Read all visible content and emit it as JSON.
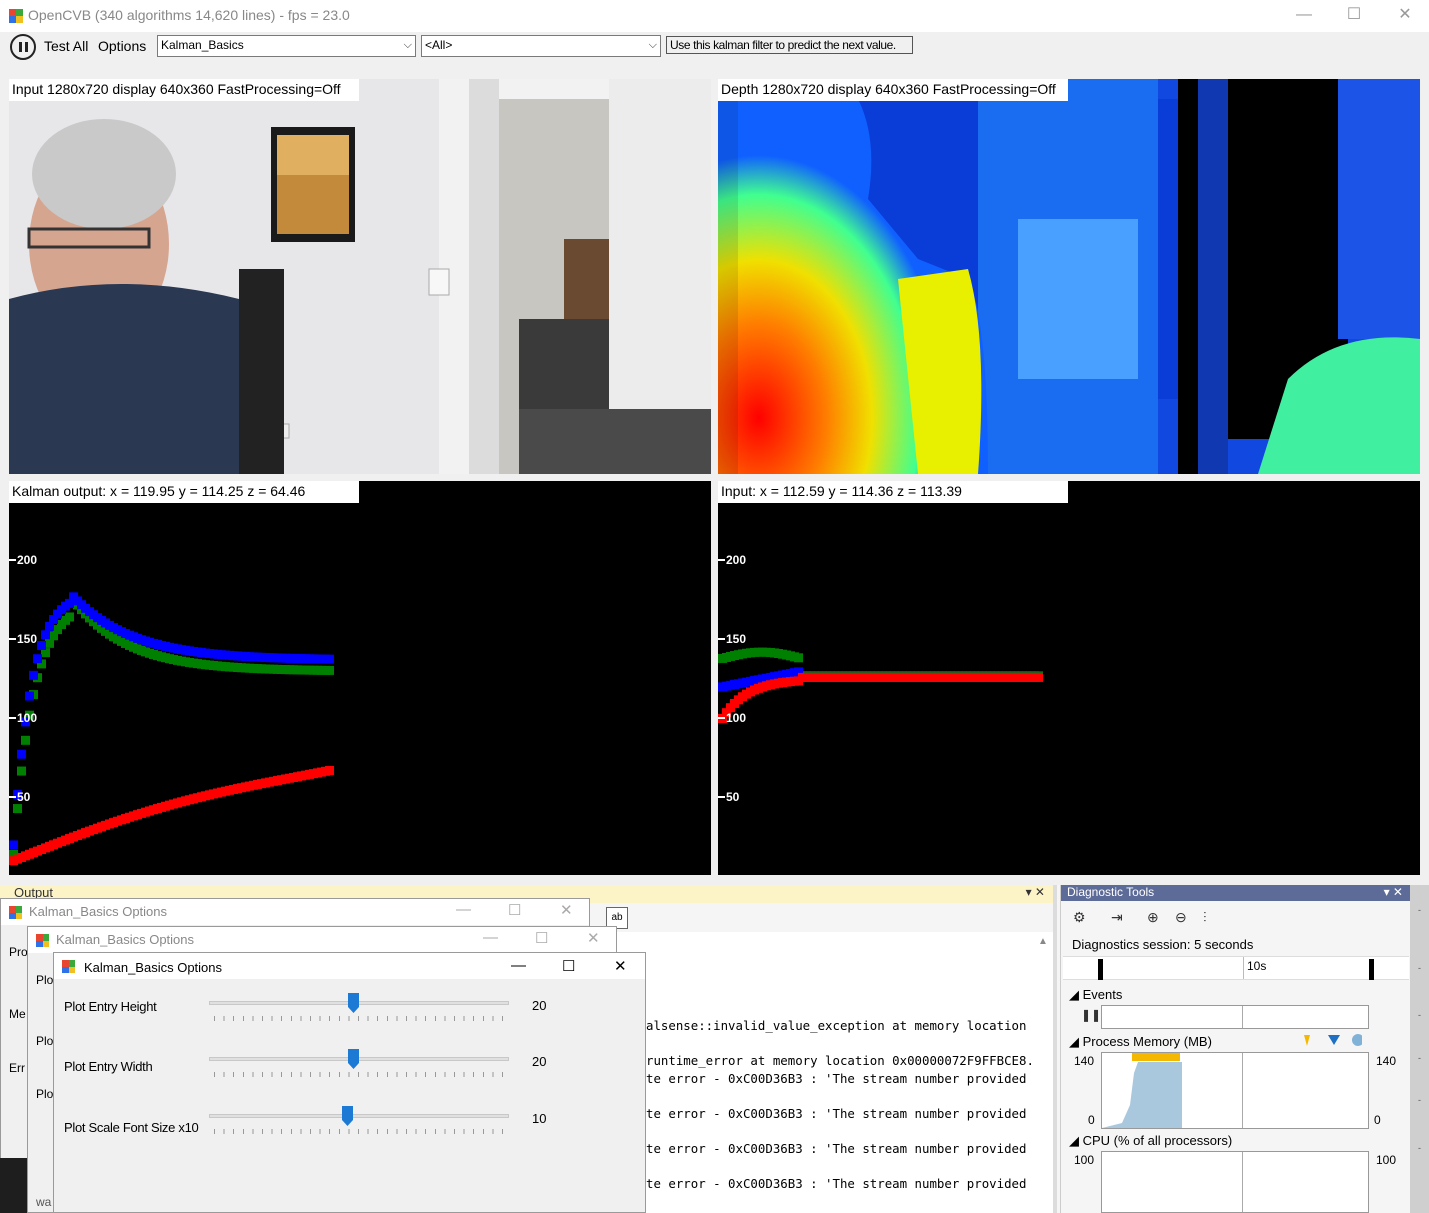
{
  "window": {
    "title": "OpenCVB (340 algorithms 14,620 lines) - fps = 23.0",
    "minimize": "—",
    "maximize": "☐",
    "close": "✕"
  },
  "toolbar": {
    "test_all": "Test All",
    "options": "Options",
    "algorithm": "Kalman_Basics",
    "group": "<All>",
    "description": "Use this kalman filter to predict the next value."
  },
  "panels": {
    "input_label": "Input 1280x720 display 640x360 FastProcessing=Off",
    "depth_label": "Depth 1280x720 display 640x360 FastProcessing=Off",
    "kalman_label": "Kalman output: x = 119.95 y = 114.25 z = 64.46",
    "raw_label": "Input: x = 112.59 y = 114.36 z = 113.39"
  },
  "plot_axis": {
    "ticks": [
      "200",
      "150",
      "100",
      "50"
    ],
    "colors": {
      "x": "#0000ff",
      "y": "#008000",
      "z": "#ff0000"
    }
  },
  "output": {
    "title": "Output",
    "controls": "▾ ✕",
    "lines": [
      "alsense::invalid_value_exception at memory location",
      "runtime_error at memory location 0x00000072F9FFBCE8.",
      "te error - 0xC00D36B3 : 'The stream number provided",
      "te error - 0xC00D36B3 : 'The stream number provided",
      "te error - 0xC00D36B3 : 'The stream number provided",
      "te error - 0xC00D36B3 : 'The stream number provided"
    ]
  },
  "options_dialogs": {
    "title": "Kalman_Basics Options",
    "back_labels_1": [
      "Pro",
      "Me",
      "Err"
    ],
    "back_labels_2": [
      "Plot",
      "Plot",
      "Plot"
    ],
    "bottom_text": "wa",
    "sliders": [
      {
        "label": "Plot Entry Height",
        "value": "20",
        "fraction": 0.48
      },
      {
        "label": "Plot Entry Width",
        "value": "20",
        "fraction": 0.48
      },
      {
        "label": "Plot Scale Font Size x10",
        "value": "10",
        "fraction": 0.46
      }
    ]
  },
  "diagnostics": {
    "title": "Diagnostic Tools",
    "controls": "▾ ✕",
    "session": "Diagnostics session: 5 seconds",
    "timeline_label": "10s",
    "events_label": "Events",
    "memory_label": "Process Memory (MB)",
    "memory_max": "140",
    "memory_min": "0",
    "cpu_label": "CPU (% of all processors)",
    "cpu_max": "100",
    "legend_colors": {
      "gc": "#f5b800",
      "snapshot": "#1f6fc4",
      "private": "#7fb2d6"
    }
  }
}
